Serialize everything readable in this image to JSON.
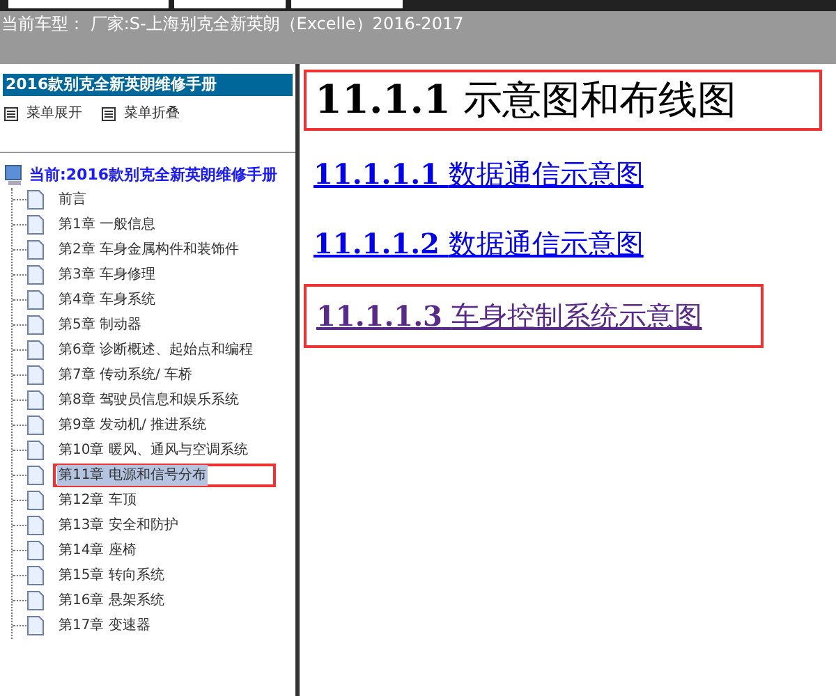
{
  "header": {
    "text": "当前车型： 厂家:S-上海别克全新英朗（Excelle）2016-2017"
  },
  "sidebar": {
    "title": "2016款别克全新英朗维修手册",
    "actions": [
      {
        "label": "菜单展开"
      },
      {
        "label": "菜单折叠"
      }
    ],
    "tree": {
      "label": "当前:2016款别克全新英朗维修手册",
      "children": [
        {
          "label": "前言",
          "selected": false,
          "highlighted": false
        },
        {
          "label": "第1章 一般信息",
          "selected": false,
          "highlighted": false
        },
        {
          "label": "第2章 车身金属构件和装饰件",
          "selected": false,
          "highlighted": false
        },
        {
          "label": "第3章 车身修理",
          "selected": false,
          "highlighted": false
        },
        {
          "label": "第4章 车身系统",
          "selected": false,
          "highlighted": false
        },
        {
          "label": "第5章 制动器",
          "selected": false,
          "highlighted": false
        },
        {
          "label": "第6章 诊断概述、起始点和编程",
          "selected": false,
          "highlighted": false
        },
        {
          "label": "第7章 传动系统/ 车桥",
          "selected": false,
          "highlighted": false
        },
        {
          "label": "第8章 驾驶员信息和娱乐系统",
          "selected": false,
          "highlighted": false
        },
        {
          "label": "第9章 发动机/ 推进系统",
          "selected": false,
          "highlighted": false
        },
        {
          "label": "第10章 暖风、通风与空调系统",
          "selected": false,
          "highlighted": false
        },
        {
          "label": "第11章 电源和信号分布",
          "selected": true,
          "highlighted": true
        },
        {
          "label": "第12章 车顶",
          "selected": false,
          "highlighted": false
        },
        {
          "label": "第13章 安全和防护",
          "selected": false,
          "highlighted": false
        },
        {
          "label": "第14章 座椅",
          "selected": false,
          "highlighted": false
        },
        {
          "label": "第15章 转向系统",
          "selected": false,
          "highlighted": false
        },
        {
          "label": "第16章 悬架系统",
          "selected": false,
          "highlighted": false
        },
        {
          "label": "第17章 变速器",
          "selected": false,
          "highlighted": false
        }
      ]
    }
  },
  "content": {
    "heading": {
      "text": "11.1.1 示意图和布线图",
      "highlighted": true
    },
    "links": [
      {
        "number": "11.1.1.1",
        "text": "数据通信示意图",
        "visited": false,
        "highlighted": false
      },
      {
        "number": "11.1.1.2",
        "text": "数据通信示意图",
        "visited": false,
        "highlighted": false
      },
      {
        "number": "11.1.1.3",
        "text": "车身控制系统示意图",
        "visited": true,
        "highlighted": true
      }
    ]
  }
}
